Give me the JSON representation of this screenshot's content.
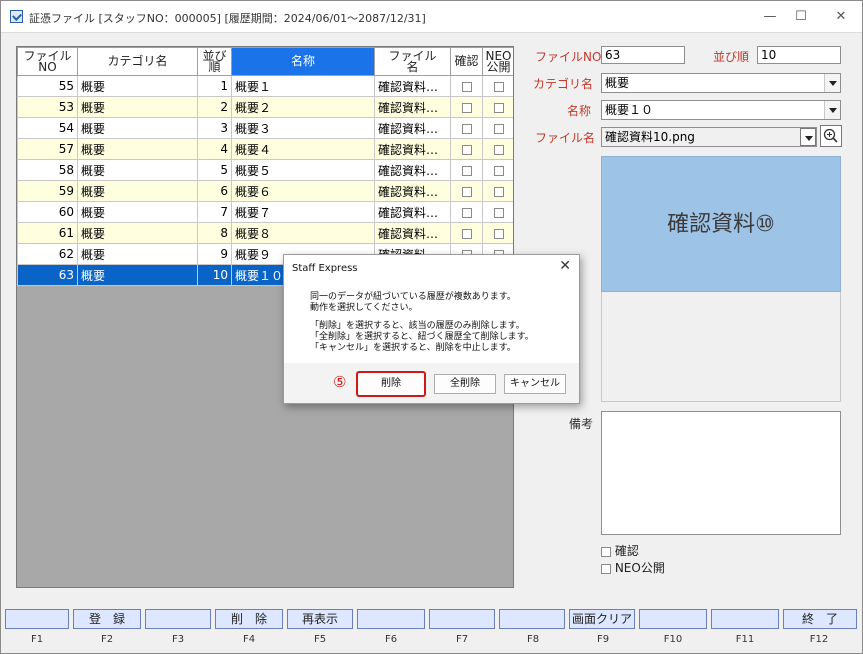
{
  "window": {
    "title": "証憑ファイル [スタッフNO：000005] [履歴期間：2024/06/01～2087/12/31]",
    "minimize_glyph": "—",
    "maximize_glyph": "☐",
    "close_glyph": "✕"
  },
  "grid": {
    "headers": {
      "file_no_1": "ファイル",
      "file_no_2": "NO",
      "category": "カテゴリ名",
      "order_1": "並び",
      "order_2": "順",
      "name": "名称",
      "filename_1": "ファイル",
      "filename_2": "名",
      "confirm": "確認",
      "neo_1": "NEO",
      "neo_2": "公開"
    },
    "rows": [
      {
        "no": "55",
        "cat": "概要",
        "ord": "1",
        "name": "概要１",
        "file": "確認資料…"
      },
      {
        "no": "53",
        "cat": "概要",
        "ord": "2",
        "name": "概要２",
        "file": "確認資料…"
      },
      {
        "no": "54",
        "cat": "概要",
        "ord": "3",
        "name": "概要３",
        "file": "確認資料…"
      },
      {
        "no": "57",
        "cat": "概要",
        "ord": "4",
        "name": "概要４",
        "file": "確認資料…"
      },
      {
        "no": "58",
        "cat": "概要",
        "ord": "5",
        "name": "概要５",
        "file": "確認資料…"
      },
      {
        "no": "59",
        "cat": "概要",
        "ord": "6",
        "name": "概要６",
        "file": "確認資料…"
      },
      {
        "no": "60",
        "cat": "概要",
        "ord": "7",
        "name": "概要７",
        "file": "確認資料…"
      },
      {
        "no": "61",
        "cat": "概要",
        "ord": "8",
        "name": "概要８",
        "file": "確認資料…"
      },
      {
        "no": "62",
        "cat": "概要",
        "ord": "9",
        "name": "概要９",
        "file": "確認資料…"
      },
      {
        "no": "63",
        "cat": "概要",
        "ord": "10",
        "name": "概要１０",
        "file": ""
      }
    ]
  },
  "detail": {
    "file_no_label": "ファイルNO",
    "file_no_value": "63",
    "order_label": "並び順",
    "order_value": "10",
    "category_label": "カテゴリ名",
    "category_value": "概要",
    "name_label": "名称",
    "name_value": "概要１０",
    "filename_label": "ファイル名",
    "filename_value": "確認資料10.png",
    "preview_text": "確認資料⑩",
    "memo_label": "備考",
    "confirm_label": "確認",
    "neo_label": "NEO公開"
  },
  "fkeys": {
    "f2_label": "登　録",
    "f4_label": "削　除",
    "f5_label": "再表示",
    "f9_label": "画面クリア",
    "f12_label": "終　了",
    "names": [
      "F1",
      "F2",
      "F3",
      "F4",
      "F5",
      "F6",
      "F7",
      "F8",
      "F9",
      "F10",
      "F11",
      "F12"
    ]
  },
  "dialog": {
    "title": "Staff Express",
    "close_glyph": "✕",
    "line1": "同一のデータが紐づいている履歴が複数あります。",
    "line2": "動作を選択してください。",
    "line3": "「削除」を選択すると、該当の履歴のみ削除します。",
    "line4": "「全削除」を選択すると、紐づく履歴全て削除します。",
    "line5": "「キャンセル」を選択すると、削除を中止します。",
    "delete_label": "削除",
    "delete_all_label": "全削除",
    "cancel_label": "キャンセル",
    "step_mark": "⑤"
  }
}
